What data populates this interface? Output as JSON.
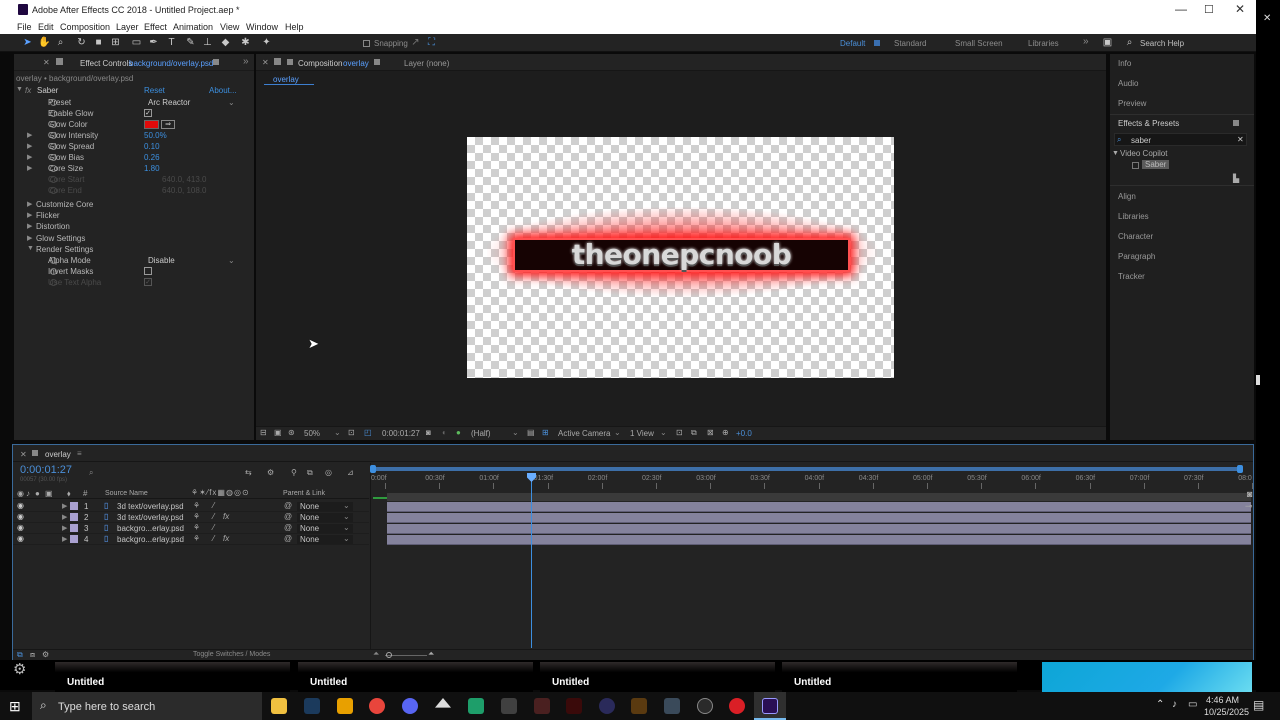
{
  "window": {
    "title": "Adobe After Effects CC 2018 - Untitled Project.aep *",
    "minimize": "—",
    "maximize": "☐",
    "close": "✕",
    "side_close": "✕"
  },
  "menu": [
    "File",
    "Edit",
    "Composition",
    "Layer",
    "Effect",
    "Animation",
    "View",
    "Window",
    "Help"
  ],
  "toolbar": {
    "snapping_label": "Snapping",
    "workspaces": [
      "Default",
      "Standard",
      "Small Screen",
      "Libraries"
    ],
    "more": "»",
    "search_placeholder": "Search Help"
  },
  "effect_controls": {
    "tab_label": "Effect Controls",
    "tab_file": "background/overlay.psd",
    "breadcrumb": "overlay • background/overlay.psd",
    "effect_name": "Saber",
    "reset": "Reset",
    "about": "About...",
    "fx_badge": "fx",
    "props": [
      {
        "label": "Preset",
        "value": "Arc Reactor",
        "type": "dropdown"
      },
      {
        "label": "Enable Glow",
        "value": "",
        "type": "checkbox",
        "checked": true
      },
      {
        "label": "Glow Color",
        "value": "",
        "type": "color",
        "color": "#e00a0a"
      },
      {
        "label": "Glow Intensity",
        "value": "50.0%",
        "type": "num"
      },
      {
        "label": "Glow Spread",
        "value": "0.10",
        "type": "num"
      },
      {
        "label": "Glow Bias",
        "value": "0.26",
        "type": "num"
      },
      {
        "label": "Core Size",
        "value": "1.80",
        "type": "num"
      },
      {
        "label": "Core Start",
        "value": "640.0, 413.0",
        "type": "dim"
      },
      {
        "label": "Core End",
        "value": "640.0, 108.0",
        "type": "dim"
      }
    ],
    "groups": [
      "Customize Core",
      "Flicker",
      "Distortion",
      "Glow Settings",
      "Render Settings"
    ],
    "render": [
      {
        "label": "Alpha Mode",
        "value": "Disable",
        "type": "dropdown"
      },
      {
        "label": "Invert Masks",
        "value": "",
        "type": "checkbox",
        "checked": false
      },
      {
        "label": "Use Text Alpha",
        "value": "",
        "type": "checkbox_dim",
        "checked": true
      }
    ]
  },
  "composition": {
    "tab_label": "Composition",
    "tab_name": "overlay",
    "layer_tab": "Layer (none)",
    "sub_tab": "overlay",
    "canvas_text": "theonepcnoob",
    "footer": {
      "zoom": "50%",
      "timecode": "0:00:01:27",
      "resolution": "(Half)",
      "camera": "Active Camera",
      "views": "1 View",
      "exposure": "+0.0"
    }
  },
  "right_panels": {
    "items": [
      "Info",
      "Audio",
      "Preview",
      "Effects & Presets"
    ],
    "search_value": "saber",
    "tree_group": "Video Copilot",
    "tree_item": "Saber",
    "lower_items": [
      "Align",
      "Libraries",
      "Character",
      "Paragraph",
      "Tracker"
    ]
  },
  "timeline": {
    "comp_name": "overlay",
    "timecode": "0:00:01:27",
    "frames_info": "00057 (30.00 fps)",
    "col_source": "Source Name",
    "col_parent": "Parent & Link",
    "ruler": [
      "0:00f",
      "00:30f",
      "01:00f",
      "01:30f",
      "02:00f",
      "02:30f",
      "03:00f",
      "03:30f",
      "04:00f",
      "04:30f",
      "05:00f",
      "05:30f",
      "06:00f",
      "06:30f",
      "07:00f",
      "07:30f",
      "08:0"
    ],
    "layers": [
      {
        "num": "1",
        "name": "3d text/overlay.psd",
        "fx": false,
        "parent": "None"
      },
      {
        "num": "2",
        "name": "3d text/overlay.psd",
        "fx": true,
        "parent": "None"
      },
      {
        "num": "3",
        "name": "backgro...erlay.psd",
        "fx": false,
        "parent": "None"
      },
      {
        "num": "4",
        "name": "backgro...erlay.psd",
        "fx": true,
        "parent": "None"
      }
    ],
    "toggle_label": "Toggle Switches / Modes"
  },
  "thumbnails": [
    "Untitled",
    "Untitled",
    "Untitled",
    "Untitled"
  ],
  "taskbar": {
    "search_placeholder": "Type here to search",
    "time": "4:46 AM",
    "date": "10/25/2025",
    "accent": "#1e90ff"
  }
}
